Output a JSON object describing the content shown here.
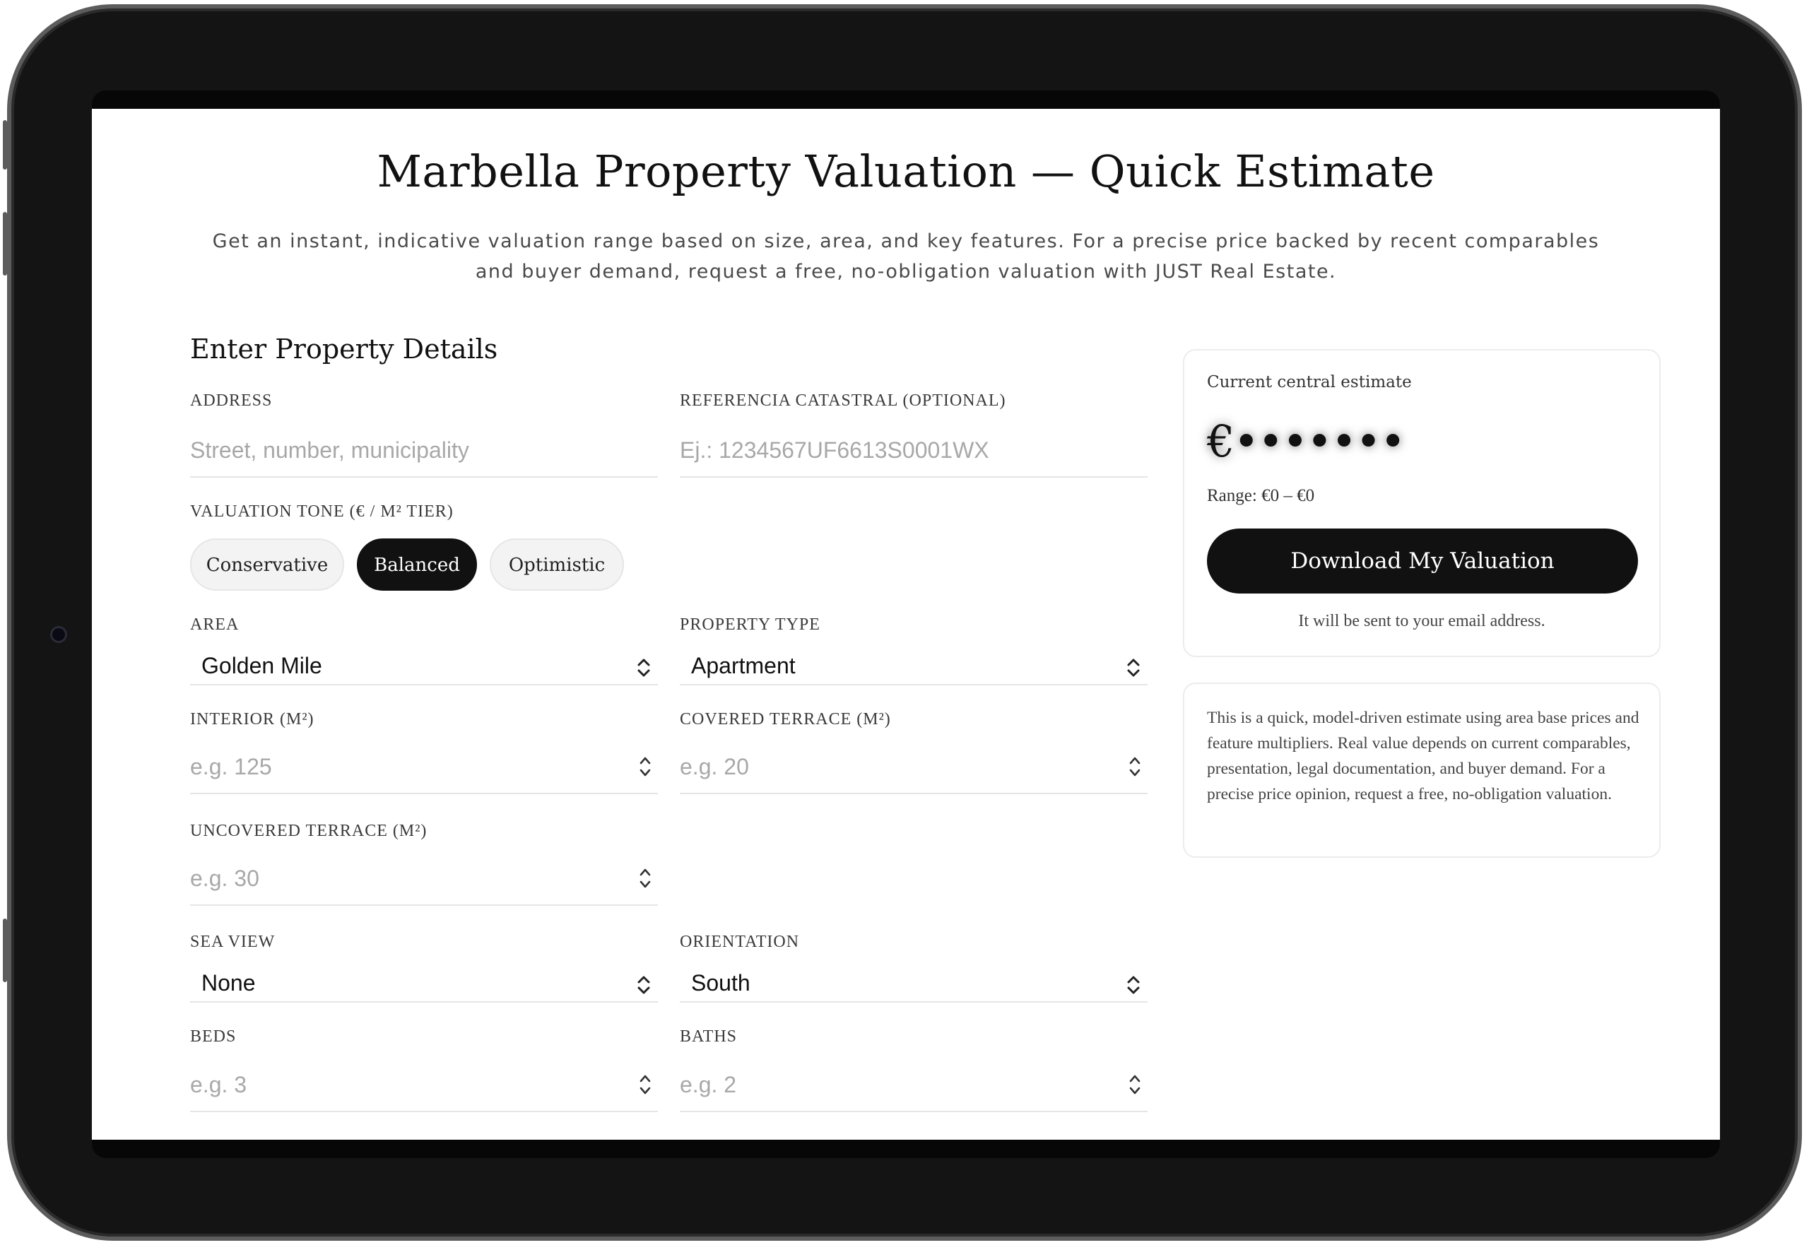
{
  "page": {
    "title": "Marbella Property Valuation — Quick Estimate",
    "subtitle": "Get an instant, indicative valuation range based on size, area, and key features. For a precise price backed by recent comparables and buyer demand, request a free, no-obligation valuation with JUST Real Estate."
  },
  "form": {
    "section_title": "Enter Property Details",
    "address": {
      "label": "Address",
      "placeholder": "Street, number, municipality"
    },
    "catastral": {
      "label": "Referencia Catastral (optional)",
      "placeholder": "Ej.: 1234567UF6613S0001WX"
    },
    "tone": {
      "label": "Valuation tone (€ / m² tier)",
      "options": [
        "Conservative",
        "Balanced",
        "Optimistic"
      ],
      "selected": "Balanced"
    },
    "area": {
      "label": "Area",
      "value": "Golden Mile"
    },
    "property_type": {
      "label": "Property type",
      "value": "Apartment"
    },
    "interior": {
      "label": "Interior (m²)",
      "placeholder": "e.g. 125"
    },
    "covered_terrace": {
      "label": "Covered terrace (m²)",
      "placeholder": "e.g. 20"
    },
    "uncovered_terrace": {
      "label": "Uncovered terrace (m²)",
      "placeholder": "e.g. 30"
    },
    "sea_view": {
      "label": "Sea view",
      "value": "None"
    },
    "orientation": {
      "label": "Orientation",
      "value": "South"
    },
    "beds": {
      "label": "Beds",
      "placeholder": "e.g. 3"
    },
    "baths": {
      "label": "Baths",
      "placeholder": "e.g. 2"
    }
  },
  "estimate": {
    "label": "Current central estimate",
    "value": "€•••••••",
    "range": "Range: €0 – €0",
    "download_label": "Download My Valuation",
    "note": "It will be sent to your email address."
  },
  "disclaimer": "This is a quick, model-driven estimate using area base prices and feature multipliers. Real value depends on current comparables, presentation, legal documentation, and buyer demand. For a precise price opinion, request a free, no-obligation valuation.",
  "colors": {
    "accent": "#111111",
    "placeholder": "#a8a8a8",
    "frame": "#141414"
  },
  "icons": {
    "stepper": "stepper-arrows-icon",
    "select": "chevron-up-down-icon"
  }
}
